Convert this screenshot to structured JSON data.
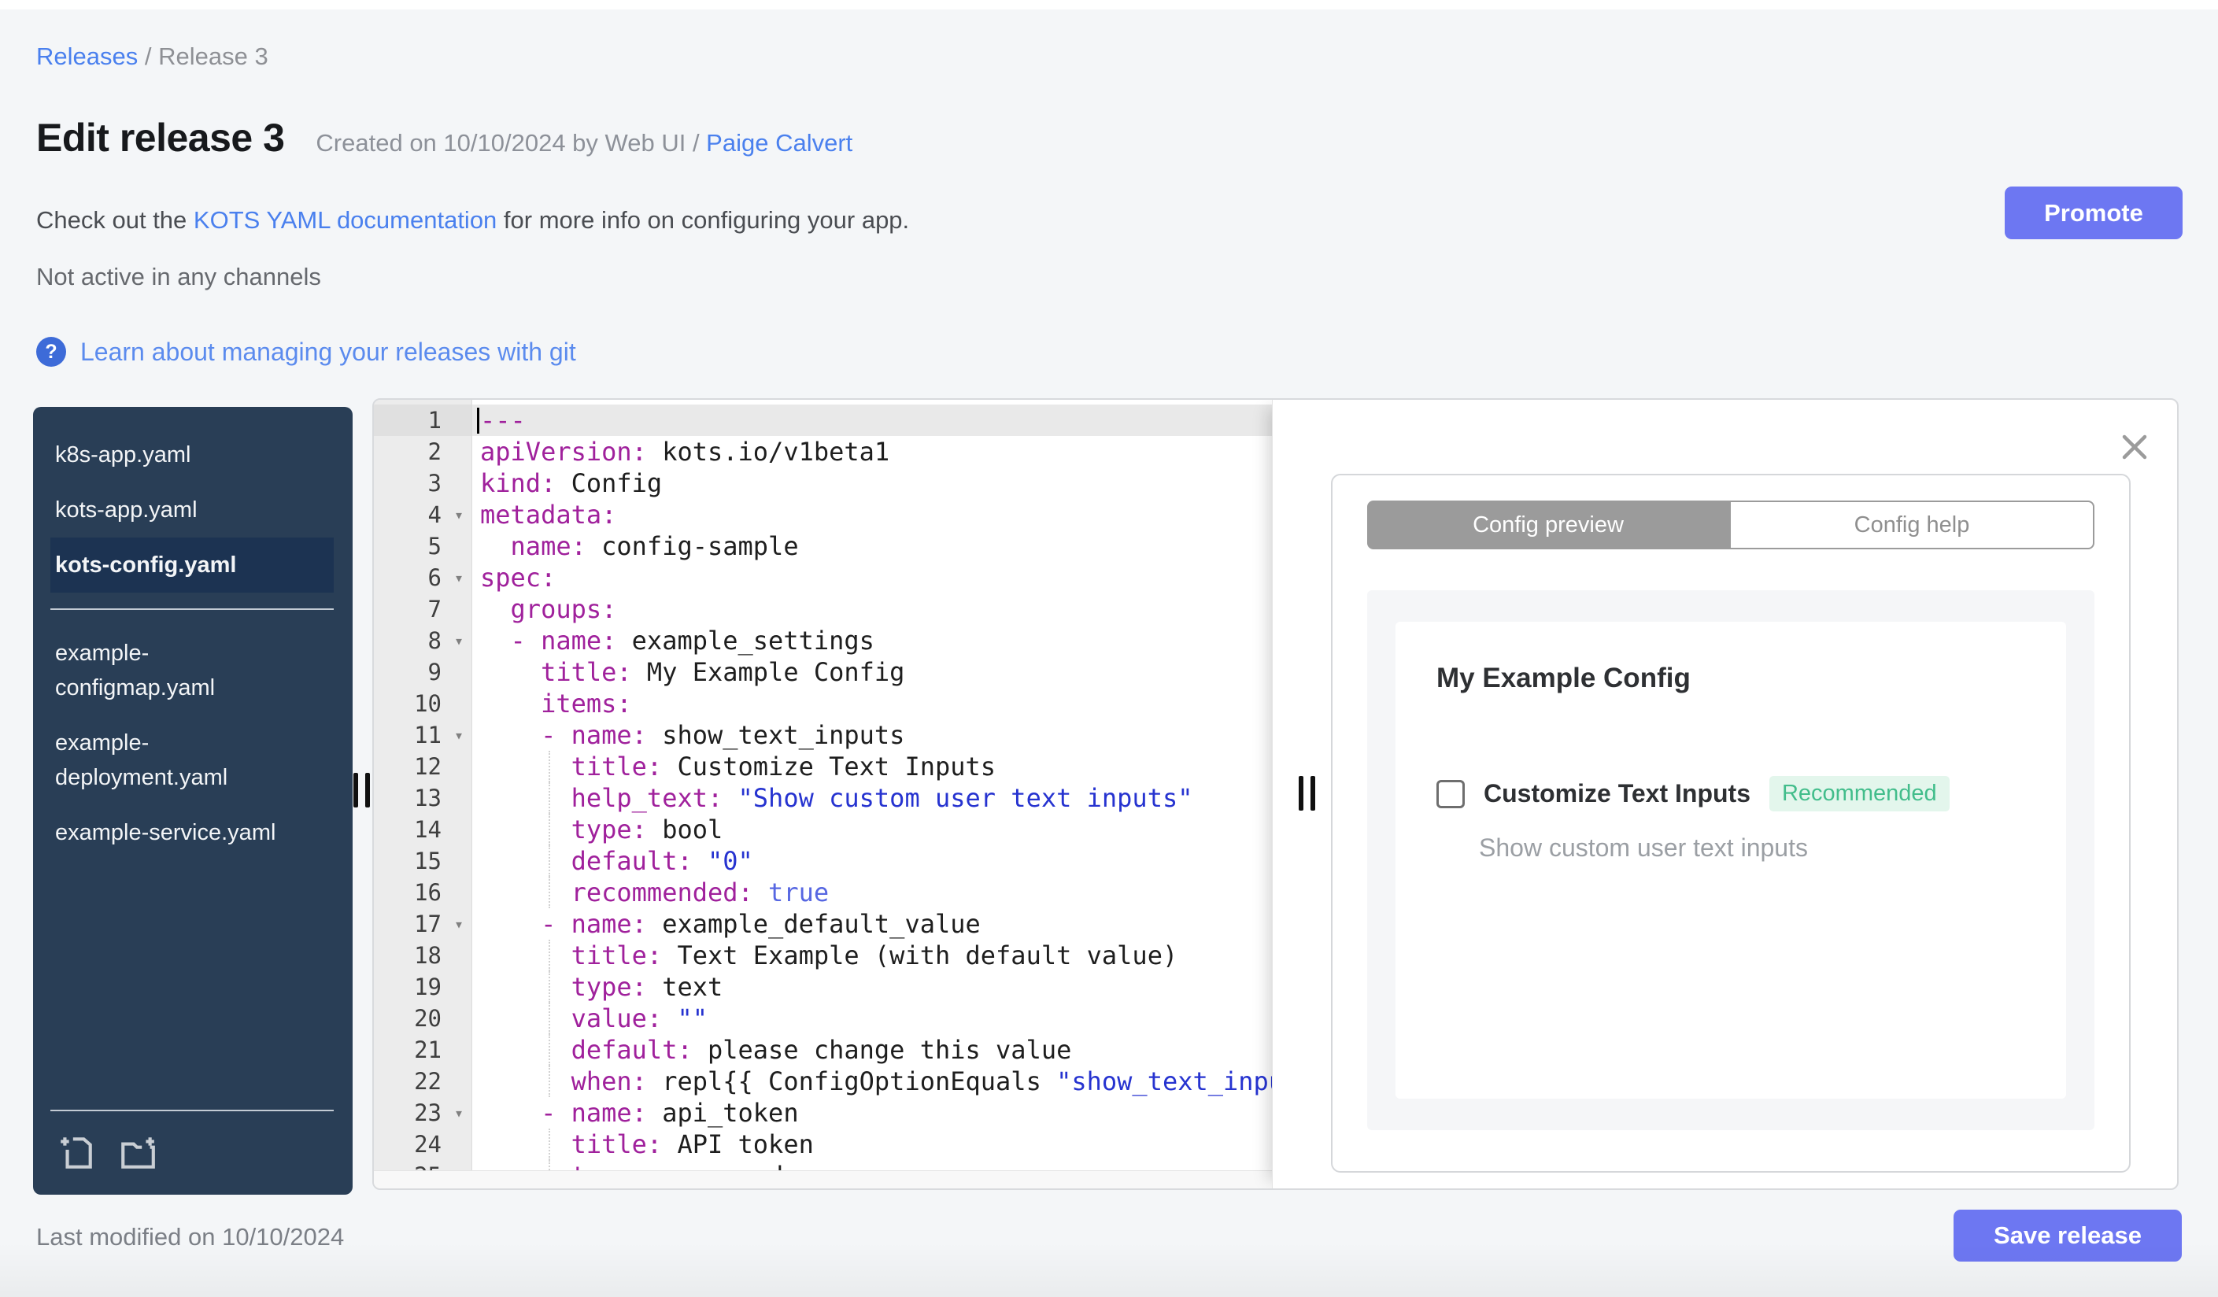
{
  "page": {
    "background": "#f4f6f8"
  },
  "colors": {
    "accent_button": "#6d77f2",
    "link": "#4a80ee",
    "link_soft": "#5b8bee",
    "sidebar_bg": "#293e56",
    "sidebar_selected_bg": "#1c3352",
    "tab_active_bg": "#9b9b9b",
    "badge_bg": "#e3f6ec",
    "badge_text": "#42bd8b",
    "yaml_key": "#a0219c",
    "yaml_string": "#2633d0",
    "yaml_bool": "#5767e2"
  },
  "breadcrumb": {
    "link": "Releases",
    "separator": " / ",
    "current": "Release 3"
  },
  "header": {
    "title": "Edit release 3",
    "created": "Created on 10/10/2024 by Web UI / ",
    "author": "Paige Calvert"
  },
  "docs_note": {
    "prefix": "Check out the ",
    "link_label": "KOTS YAML documentation",
    "suffix": " for more info on configuring your app."
  },
  "status_line": "Not active in any channels",
  "git_help": {
    "icon": "?",
    "label": "Learn about managing your releases with git"
  },
  "promote_button_label": "Promote",
  "sidebar": {
    "files": [
      {
        "label": "k8s-app.yaml"
      },
      {
        "label": "kots-app.yaml"
      },
      {
        "label": "kots-config.yaml",
        "selected": true
      },
      {
        "divider": true
      },
      {
        "label": "example-configmap.yaml"
      },
      {
        "label": "example-deployment.yaml"
      },
      {
        "label": "example-service.yaml"
      }
    ]
  },
  "editor": {
    "fold_icon": "▾",
    "lines": [
      {
        "num": 1,
        "active": true,
        "seg": [
          [
            "k",
            "---"
          ]
        ]
      },
      {
        "num": 2,
        "seg": [
          [
            "k",
            "apiVersion:"
          ],
          [
            "p",
            " kots.io/v1beta1"
          ]
        ]
      },
      {
        "num": 3,
        "seg": [
          [
            "k",
            "kind:"
          ],
          [
            "p",
            " Config"
          ]
        ]
      },
      {
        "num": 4,
        "fold": true,
        "seg": [
          [
            "k",
            "metadata:"
          ]
        ]
      },
      {
        "num": 5,
        "seg": [
          [
            "p",
            "  "
          ],
          [
            "k",
            "name:"
          ],
          [
            "p",
            " config-sample"
          ]
        ]
      },
      {
        "num": 6,
        "fold": true,
        "seg": [
          [
            "k",
            "spec:"
          ]
        ]
      },
      {
        "num": 7,
        "seg": [
          [
            "p",
            "  "
          ],
          [
            "k",
            "groups:"
          ]
        ]
      },
      {
        "num": 8,
        "fold": true,
        "seg": [
          [
            "p",
            "  "
          ],
          [
            "k",
            "- name:"
          ],
          [
            "p",
            " example_settings"
          ]
        ]
      },
      {
        "num": 9,
        "seg": [
          [
            "p",
            "    "
          ],
          [
            "k",
            "title:"
          ],
          [
            "p",
            " My Example Config"
          ]
        ]
      },
      {
        "num": 10,
        "seg": [
          [
            "p",
            "    "
          ],
          [
            "k",
            "items:"
          ]
        ]
      },
      {
        "num": 11,
        "fold": true,
        "seg": [
          [
            "p",
            "    "
          ],
          [
            "k",
            "- name:"
          ],
          [
            "p",
            " show_text_inputs"
          ]
        ]
      },
      {
        "num": 12,
        "guide": true,
        "seg": [
          [
            "p",
            "      "
          ],
          [
            "k",
            "title:"
          ],
          [
            "p",
            " Customize Text Inputs"
          ]
        ]
      },
      {
        "num": 13,
        "guide": true,
        "seg": [
          [
            "p",
            "      "
          ],
          [
            "k",
            "help_text:"
          ],
          [
            "p",
            " "
          ],
          [
            "s",
            "\"Show custom user text inputs\""
          ]
        ]
      },
      {
        "num": 14,
        "guide": true,
        "seg": [
          [
            "p",
            "      "
          ],
          [
            "k",
            "type:"
          ],
          [
            "p",
            " bool"
          ]
        ]
      },
      {
        "num": 15,
        "guide": true,
        "seg": [
          [
            "p",
            "      "
          ],
          [
            "k",
            "default:"
          ],
          [
            "p",
            " "
          ],
          [
            "s",
            "\"0\""
          ]
        ]
      },
      {
        "num": 16,
        "guide": true,
        "seg": [
          [
            "p",
            "      "
          ],
          [
            "k",
            "recommended:"
          ],
          [
            "p",
            " "
          ],
          [
            "b",
            "true"
          ]
        ]
      },
      {
        "num": 17,
        "fold": true,
        "seg": [
          [
            "p",
            "    "
          ],
          [
            "k",
            "- name:"
          ],
          [
            "p",
            " example_default_value"
          ]
        ]
      },
      {
        "num": 18,
        "guide": true,
        "seg": [
          [
            "p",
            "      "
          ],
          [
            "k",
            "title:"
          ],
          [
            "p",
            " Text Example (with default value)"
          ]
        ]
      },
      {
        "num": 19,
        "guide": true,
        "seg": [
          [
            "p",
            "      "
          ],
          [
            "k",
            "type:"
          ],
          [
            "p",
            " text"
          ]
        ]
      },
      {
        "num": 20,
        "guide": true,
        "seg": [
          [
            "p",
            "      "
          ],
          [
            "k",
            "value:"
          ],
          [
            "p",
            " "
          ],
          [
            "s",
            "\"\""
          ]
        ]
      },
      {
        "num": 21,
        "guide": true,
        "seg": [
          [
            "p",
            "      "
          ],
          [
            "k",
            "default:"
          ],
          [
            "p",
            " please change this value"
          ]
        ]
      },
      {
        "num": 22,
        "guide": true,
        "seg": [
          [
            "p",
            "      "
          ],
          [
            "k",
            "when:"
          ],
          [
            "p",
            " repl{{ ConfigOptionEquals "
          ],
          [
            "s",
            "\"show_text_inputs\""
          ],
          [
            "p",
            " }}"
          ]
        ]
      },
      {
        "num": 23,
        "fold": true,
        "seg": [
          [
            "p",
            "    "
          ],
          [
            "k",
            "- name:"
          ],
          [
            "p",
            " api_token"
          ]
        ]
      },
      {
        "num": 24,
        "guide": true,
        "seg": [
          [
            "p",
            "      "
          ],
          [
            "k",
            "title:"
          ],
          [
            "p",
            " API token"
          ]
        ]
      },
      {
        "num": 25,
        "guide": true,
        "seg": [
          [
            "p",
            "      "
          ],
          [
            "k",
            "type:"
          ],
          [
            "p",
            " password"
          ]
        ]
      }
    ]
  },
  "preview": {
    "tabs": [
      {
        "label": "Config preview",
        "active": true
      },
      {
        "label": "Config help",
        "active": false
      }
    ],
    "config": {
      "group_title": "My Example Config",
      "item_label": "Customize Text Inputs",
      "badge": "Recommended",
      "help_text": "Show custom user text inputs",
      "checked": false
    }
  },
  "footer": {
    "last_modified": "Last modified on 10/10/2024",
    "save_button_label": "Save release"
  }
}
